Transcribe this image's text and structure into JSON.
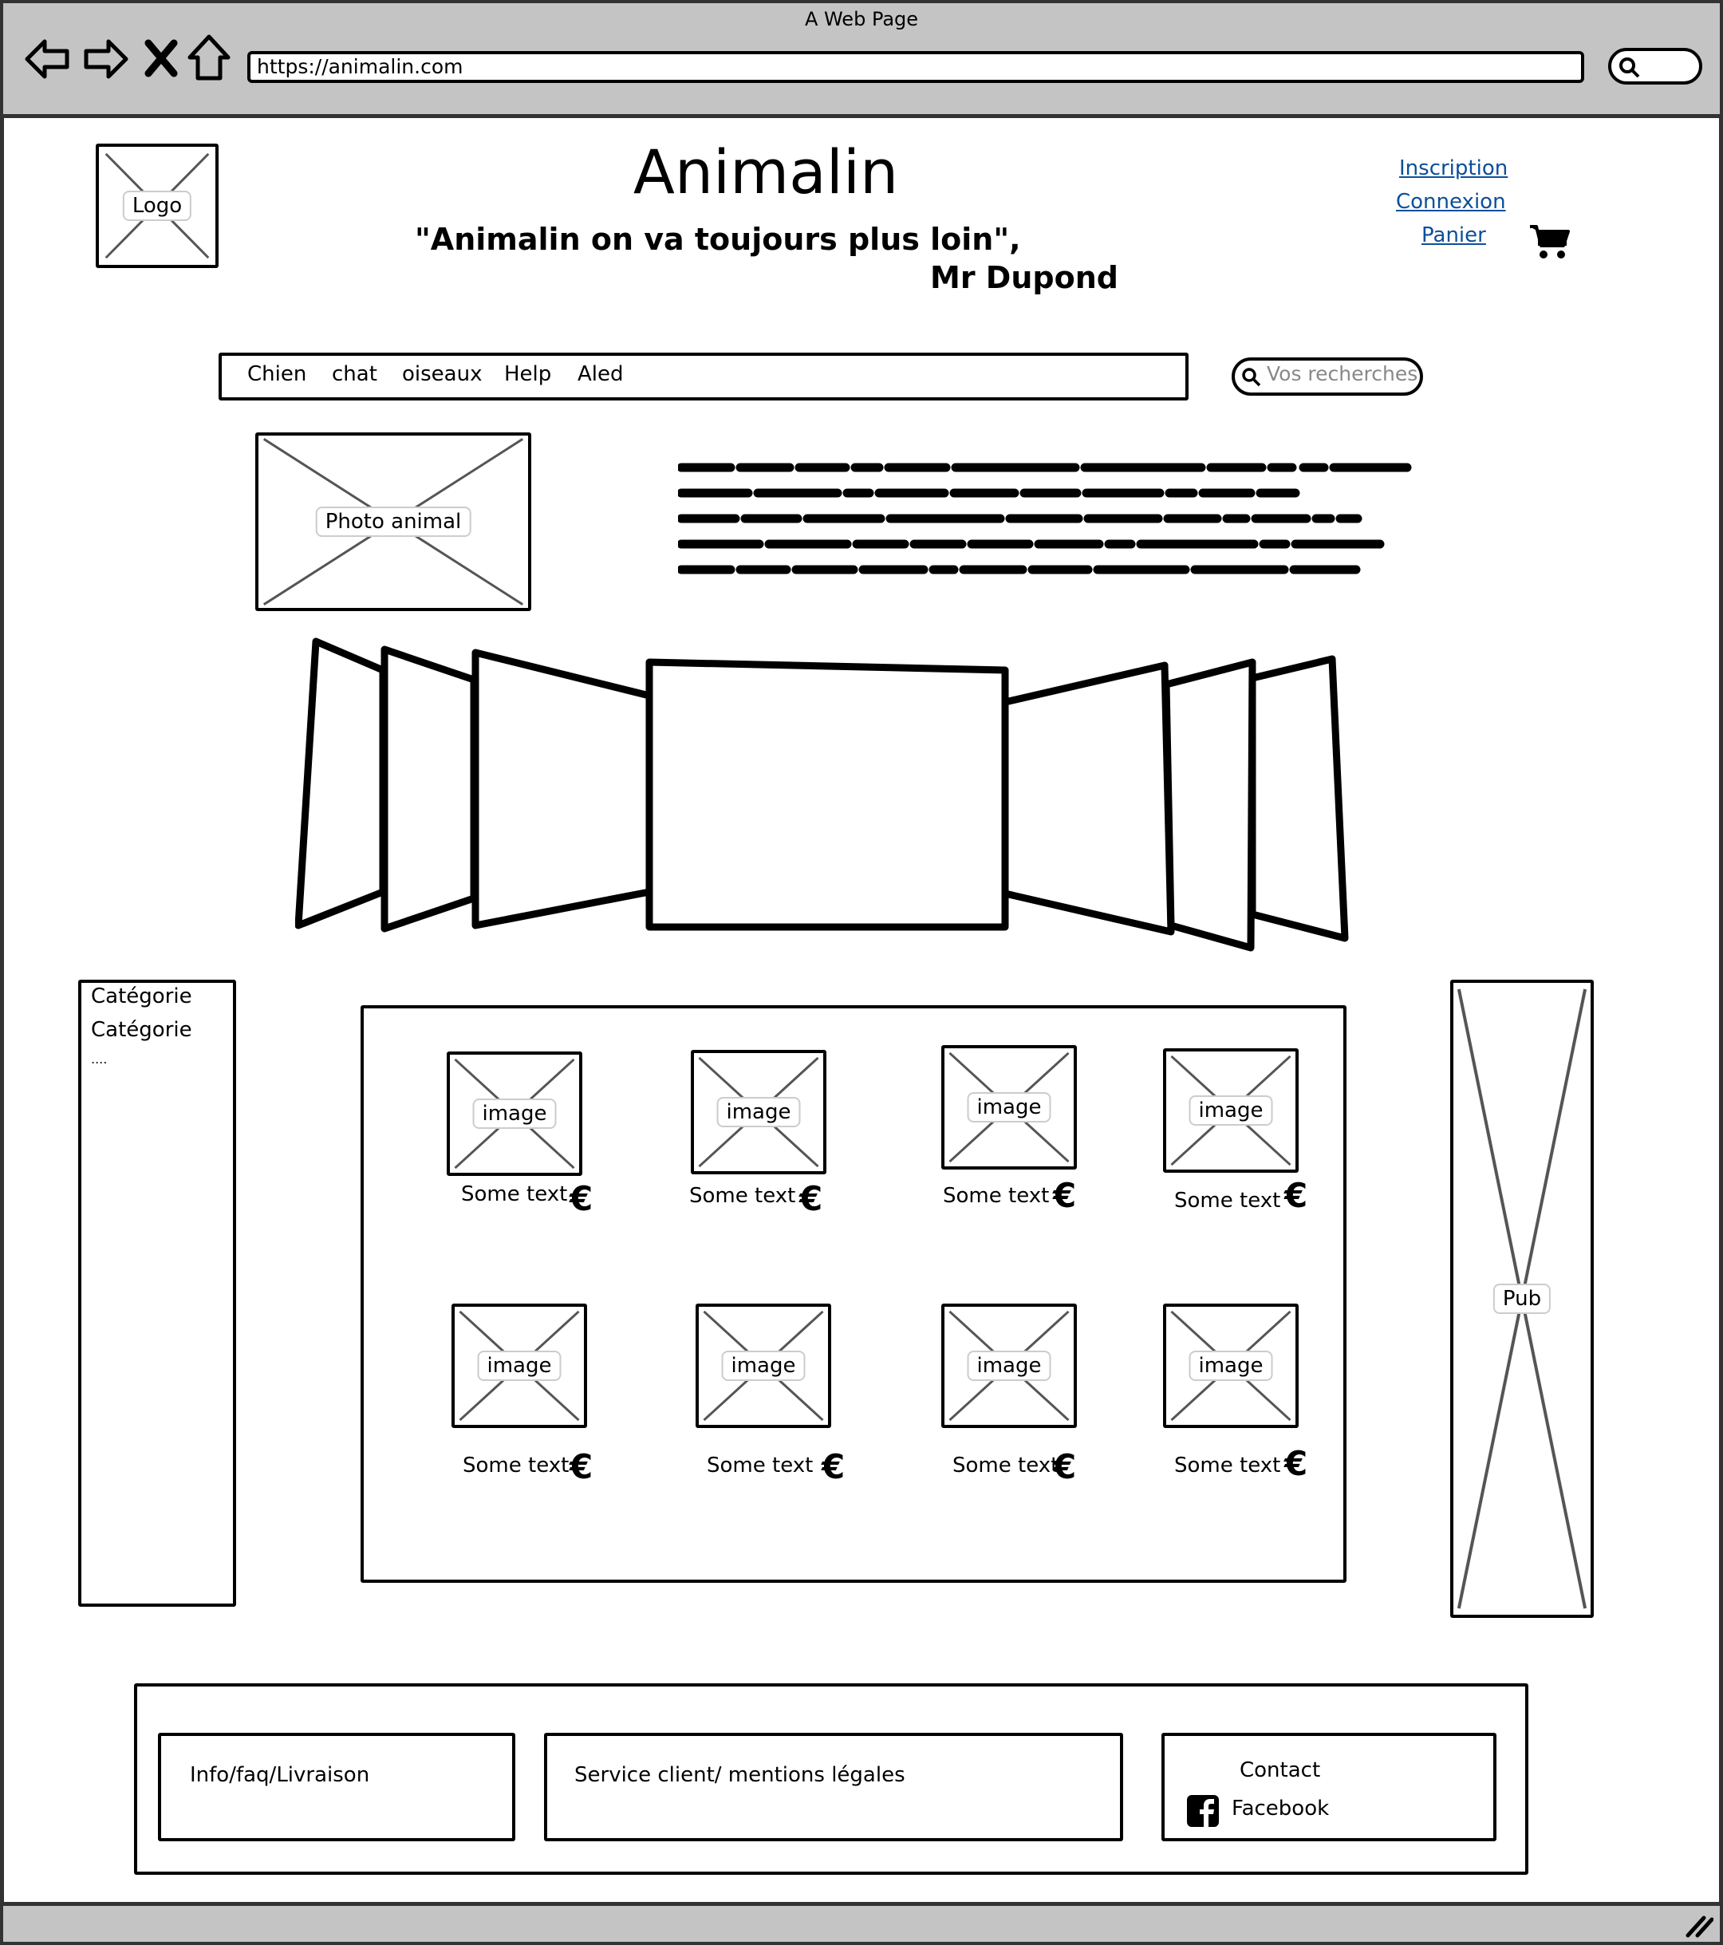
{
  "browser": {
    "window_title": "A Web Page",
    "url": "https://animalin.com"
  },
  "header": {
    "logo_label": "Logo",
    "site_title": "Animalin",
    "quote": "\"Animalin on va toujours plus loin\",",
    "quote_author": "Mr Dupond",
    "links": {
      "inscription": "Inscription",
      "connexion": "Connexion",
      "panier": "Panier"
    },
    "cart_icon": "shopping-cart-icon"
  },
  "nav": {
    "items": [
      {
        "label": "Chien"
      },
      {
        "label": "chat"
      },
      {
        "label": "oiseaux"
      },
      {
        "label": "Help"
      },
      {
        "label": "Aled"
      }
    ],
    "search_placeholder": "Vos recherches"
  },
  "intro": {
    "photo_label": "Photo animal"
  },
  "sidebar": {
    "categories": [
      "Catégorie",
      "Catégorie",
      "...."
    ]
  },
  "products": [
    {
      "image_label": "image",
      "text": "Some text",
      "currency": "€"
    },
    {
      "image_label": "image",
      "text": "Some text",
      "currency": "€"
    },
    {
      "image_label": "image",
      "text": "Some text",
      "currency": "€"
    },
    {
      "image_label": "image",
      "text": "Some text",
      "currency": "€"
    },
    {
      "image_label": "image",
      "text": "Some text",
      "currency": "€"
    },
    {
      "image_label": "image",
      "text": "Some text",
      "currency": "€"
    },
    {
      "image_label": "image",
      "text": "Some text",
      "currency": "€"
    },
    {
      "image_label": "image",
      "text": "Some text",
      "currency": "€"
    }
  ],
  "ad": {
    "label": "Pub"
  },
  "footer": {
    "info": "Info/faq/Livraison",
    "service": "Service client/ mentions légales",
    "contact": "Contact",
    "facebook": "Facebook"
  }
}
